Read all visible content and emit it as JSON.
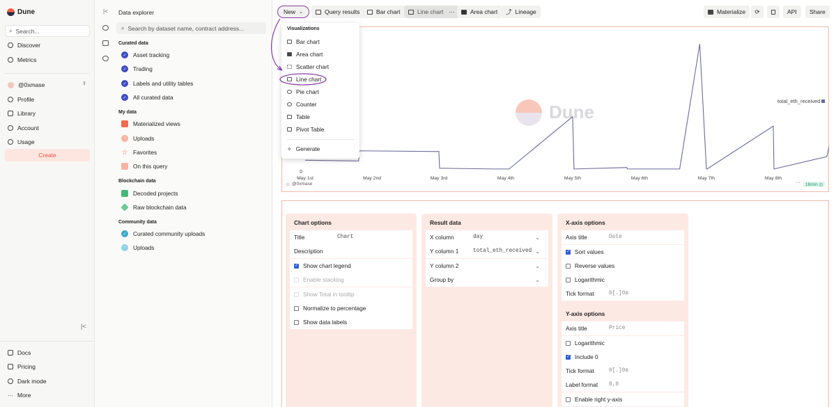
{
  "app": {
    "name": "Dune"
  },
  "leftnav": {
    "search_placeholder": "Search...",
    "top_items": [
      {
        "label": "Discover",
        "icon": "compass-icon"
      },
      {
        "label": "Metrics",
        "icon": "gauge-icon"
      }
    ],
    "user": "@0xmase",
    "user_items": [
      {
        "label": "Profile",
        "icon": "user-icon"
      },
      {
        "label": "Library",
        "icon": "library-icon"
      },
      {
        "label": "Account",
        "icon": "gear-icon"
      },
      {
        "label": "Usage",
        "icon": "usage-icon"
      }
    ],
    "create_label": "Create",
    "bottom_items": [
      {
        "label": "Docs",
        "icon": "docs-icon"
      },
      {
        "label": "Pricing",
        "icon": "tag-icon"
      },
      {
        "label": "Dark mode",
        "icon": "moon-icon"
      },
      {
        "label": "More",
        "icon": "dots-icon"
      }
    ]
  },
  "explorer": {
    "title": "Data explorer",
    "search_placeholder": "Search by dataset name, contract address...",
    "curated": {
      "heading": "Curated data",
      "items": [
        "Asset tracking",
        "Trading",
        "Labels and utility tables",
        "All curated data"
      ]
    },
    "mydata": {
      "heading": "My data",
      "items": [
        "Materialized views",
        "Uploads",
        "Favorites",
        "On this query"
      ]
    },
    "blockchain": {
      "heading": "Blockchain data",
      "items": [
        "Decoded projects",
        "Raw blockchain data"
      ]
    },
    "community": {
      "heading": "Community data",
      "items": [
        "Curated community uploads",
        "Uploads"
      ]
    }
  },
  "toolbar": {
    "new_label": "New",
    "tabs": [
      "Query results",
      "Bar chart",
      "Line chart",
      "Area chart",
      "Lineage"
    ],
    "materialize": "Materialize",
    "api": "API",
    "share": "Share"
  },
  "dropdown": {
    "heading": "Visualizations",
    "items": [
      "Bar chart",
      "Area chart",
      "Scatter chart",
      "Line chart",
      "Pie chart",
      "Counter",
      "Table",
      "Pivot Table"
    ],
    "generate": "Generate"
  },
  "chart": {
    "watermark": "Dune",
    "legend": "total_eth_received",
    "author": "@0xmase",
    "age": "16min",
    "zero_tick": "0"
  },
  "chart_data": {
    "type": "line",
    "x_ticks": [
      "May 1st",
      "May 2nd",
      "May 3rd",
      "May 4th",
      "May 5th",
      "May 6th",
      "May 7th",
      "May 8th"
    ],
    "y_ticks": [
      "0"
    ],
    "series": [
      {
        "name": "total_eth_received",
        "x": [
          0,
          0.8,
          0.81,
          2.0,
          2.01,
          2.83,
          3.0,
          3.05,
          4.0,
          4.02,
          4.81,
          4.82,
          5.0,
          5.01,
          5.2,
          5.25,
          5.6,
          5.9,
          6.0,
          6.01,
          7.0,
          7.01,
          7.8,
          8.0
        ],
        "y": [
          15,
          14,
          28,
          27,
          4,
          3,
          3,
          3,
          75,
          3,
          5,
          3,
          3,
          3,
          3,
          3,
          3,
          175,
          3,
          3,
          62,
          3,
          20,
          100
        ],
        "color": "#6b6a9a"
      }
    ],
    "ylim": [
      0,
      180
    ],
    "grid": false,
    "legend_position": "right"
  },
  "chart_options": {
    "title": "Chart options",
    "fields": {
      "title_label": "Title",
      "title_value": "Chart",
      "description_label": "Description"
    },
    "checks": [
      {
        "label": "Show chart legend",
        "checked": true,
        "disabled": false
      },
      {
        "label": "Enable stacking",
        "checked": false,
        "disabled": true
      },
      {
        "label": "Show Total in tooltip",
        "checked": false,
        "disabled": true
      },
      {
        "label": "Normalize to percentage",
        "checked": false,
        "disabled": false
      },
      {
        "label": "Show data labels",
        "checked": false,
        "disabled": false
      }
    ]
  },
  "result_data": {
    "title": "Result data",
    "rows": [
      {
        "label": "X column",
        "value": "day"
      },
      {
        "label": "Y column 1",
        "value": "total_eth_received"
      },
      {
        "label": "Y column 2",
        "value": ""
      },
      {
        "label": "Group by",
        "value": ""
      }
    ]
  },
  "xaxis": {
    "title": "X-axis options",
    "axis_title_label": "Axis title",
    "axis_title_value": "Date",
    "checks": [
      {
        "label": "Sort values",
        "checked": true
      },
      {
        "label": "Reverse values",
        "checked": false
      },
      {
        "label": "Logarithmic",
        "checked": false
      }
    ],
    "tick_format_label": "Tick format",
    "tick_format_value": "0[.]0a"
  },
  "yaxis": {
    "title": "Y-axis options",
    "axis_title_label": "Axis title",
    "axis_title_value": "Price",
    "checks": [
      {
        "label": "Logarithmic",
        "checked": false
      },
      {
        "label": "Include 0",
        "checked": true
      }
    ],
    "tick_format_label": "Tick format",
    "tick_format_value": "0[.]0a",
    "label_format_label": "Label format",
    "label_format_value": "0,0",
    "right_axis_label": "Enable right y-axis",
    "right_axis_checked": false
  }
}
